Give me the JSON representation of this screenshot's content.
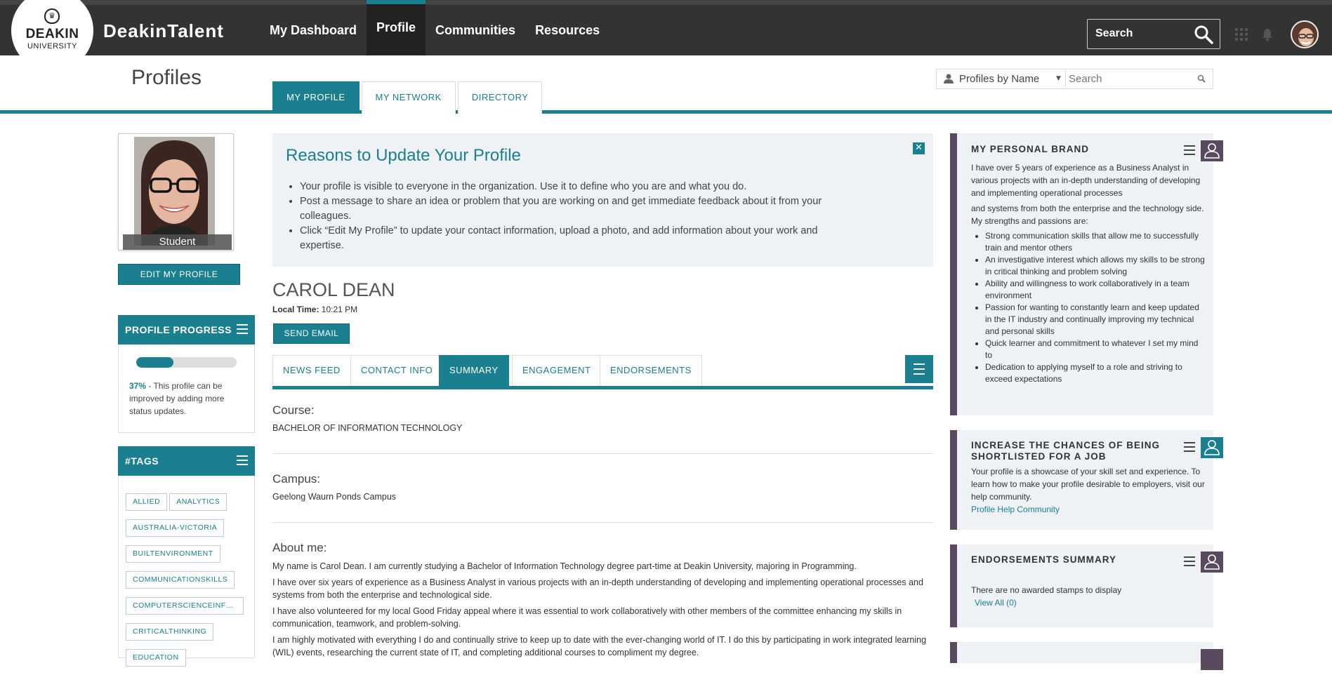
{
  "topbar": {
    "logo_line1": "DEAKIN",
    "logo_line2": "UNIVERSITY",
    "brand": "DeakinTalent",
    "nav": [
      {
        "label": "My Dashboard"
      },
      {
        "label": "Profile"
      },
      {
        "label": "Communities"
      },
      {
        "label": "Resources"
      }
    ],
    "search_label": "Search"
  },
  "subheader": {
    "title": "Profiles",
    "tabs": [
      {
        "label": "MY PROFILE"
      },
      {
        "label": "MY NETWORK"
      },
      {
        "label": "DIRECTORY"
      }
    ],
    "search_scope": "Profiles by Name",
    "search_placeholder": "Search"
  },
  "left": {
    "photo_label": "Student",
    "edit_button": "EDIT MY PROFILE",
    "progress": {
      "title": "PROFILE PROGRESS",
      "percent": 37,
      "percent_text": "37%",
      "text": " - This profile can be improved by adding more status updates."
    },
    "tags_title": "#TAGS",
    "tags": [
      "ALLIED",
      "ANALYTICS",
      "AUSTRALIA-VICTORIA",
      "BUILTENVIRONMENT",
      "COMMUNICATIONSKILLS",
      "COMPUTERSCIENCEINFOR...",
      "CRITICALTHINKING",
      "EDUCATION"
    ]
  },
  "reasons": {
    "title": "Reasons to Update Your Profile",
    "items": [
      "Your profile is visible to everyone in the organization. Use it to define who you are and what you do.",
      "Post a message to share an idea or problem that you are working on and get immediate feedback about it from your colleagues.",
      "Click “Edit My Profile” to update your contact information, upload a photo, and add information about your work and expertise."
    ]
  },
  "person": {
    "name": "CAROL DEAN",
    "local_time_label": "Local Time:",
    "local_time": " 10:21 PM",
    "email_button": "SEND EMAIL"
  },
  "profile_tabs": [
    {
      "label": "NEWS FEED"
    },
    {
      "label": "CONTACT INFO"
    },
    {
      "label": "SUMMARY"
    },
    {
      "label": "ENGAGEMENT"
    },
    {
      "label": "ENDORSEMENTS"
    }
  ],
  "summary": {
    "course_label": "Course:",
    "course": "BACHELOR OF INFORMATION TECHNOLOGY",
    "campus_label": "Campus:",
    "campus": "Geelong Waurn Ponds Campus",
    "about_label": "About me:",
    "about": [
      "My name is Carol Dean. I am currently studying a Bachelor of Information Technology degree part-time at Deakin University, majoring in Programming.",
      "I have over six years of experience as a Business Analyst in various projects with an in-depth understanding of developing and implementing operational processes and systems from both the enterprise and technological side.",
      "I have also volunteered for my local Good Friday appeal where it was essential to work collaboratively with other members of the committee enhancing my skills in communication, teamwork, and problem-solving.",
      "I am highly motivated with everything I do and continually strive to keep up to date with the ever-changing world of IT. I do this by participating in work integrated learning (WIL) events, researching the current state of IT, and completing additional courses to compliment my degree."
    ]
  },
  "right": {
    "brand": {
      "title": "MY PERSONAL BRAND",
      "p1": "I have over 5 years of experience as a Business Analyst in various projects with an in-depth understanding of developing and implementing operational processes",
      "p2": "and systems from both the enterprise and the technology side. My strengths and passions are:",
      "items": [
        "Strong communication skills that allow me to successfully train and mentor others",
        "An investigative interest which allows my skills to be strong in critical thinking and problem solving",
        "Ability and willingness to work collaboratively in a team environment",
        "Passion for wanting to constantly learn and keep updated in the IT industry and continually improving my technical and personal skills",
        "Quick learner and commitment to whatever I set my mind to",
        "Dedication to applying myself to a role and striving to exceed expectations"
      ]
    },
    "shortlist": {
      "title": "INCREASE THE CHANCES OF BEING SHORTLISTED FOR A JOB",
      "text": "Your profile is a showcase of your skill set and experience. To learn how to make your profile desirable to employers, visit our help community.",
      "link": "Profile Help Community"
    },
    "endorsements": {
      "title": "ENDORSEMENTS SUMMARY",
      "text": "There are no awarded stamps to display",
      "link": "View All (0)"
    }
  },
  "colors": {
    "accent": "#1a7f8f",
    "topbar": "#333333",
    "card_accent": "#5a4a60"
  }
}
